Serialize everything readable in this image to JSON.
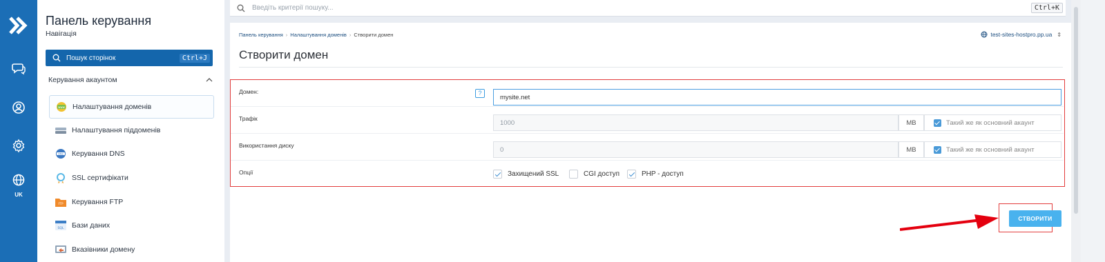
{
  "rail": {
    "lang": "UK",
    "icons": [
      "logo-icon",
      "chat-icon",
      "user-icon",
      "settings-icon",
      "globe-icon"
    ]
  },
  "nav": {
    "title": "Панель керування",
    "subtitle": "Навігація",
    "search_label": "Пошук сторінок",
    "search_shortcut": "Ctrl+J",
    "group": "Керування акаунтом",
    "items": [
      {
        "label": "Налаштування доменів",
        "icon": "domain-settings-icon",
        "color": "#7cc04a",
        "active": true
      },
      {
        "label": "Налаштування піддоменів",
        "icon": "subdomain-icon",
        "color": "#7d8ea0"
      },
      {
        "label": "Керування DNS",
        "icon": "dns-icon",
        "color": "#3b78c2"
      },
      {
        "label": "SSL сертифікати",
        "icon": "ssl-icon",
        "color": "#58b8e6"
      },
      {
        "label": "Керування FTP",
        "icon": "ftp-icon",
        "color": "#f08a2a"
      },
      {
        "label": "Бази даних",
        "icon": "database-icon",
        "color": "#3c7ec6"
      },
      {
        "label": "Вказівники домену",
        "icon": "domain-pointer-icon",
        "color": "#d7663b"
      }
    ]
  },
  "topsearch": {
    "placeholder": "Введіть критерії пошуку...",
    "shortcut": "Ctrl+K"
  },
  "breadcrumb": [
    "Панель керування",
    "Налаштування доменів",
    "Створити домен"
  ],
  "site": "test-sites-hostpro.pp.ua",
  "page_title": "Створити домен",
  "form": {
    "domain_label": "Домен:",
    "help": "?",
    "domain_value": "mysite.net",
    "traffic_label": "Трафік",
    "traffic_value": "1000",
    "disk_label": "Використання диску",
    "disk_value": "0",
    "unit": "MB",
    "same_as_main": "Такий же як основний акаунт",
    "options_label": "Опції",
    "options": [
      {
        "label": "Захищений SSL",
        "checked": true
      },
      {
        "label": "CGI доступ",
        "checked": false
      },
      {
        "label": "PHP - доступ",
        "checked": true
      }
    ]
  },
  "create_button": "СТВОРИТИ",
  "colors": {
    "rail": "#1b6eb6",
    "nav_search": "#1466ac",
    "button": "#49b2ee",
    "highlight": "#e23a3a"
  }
}
